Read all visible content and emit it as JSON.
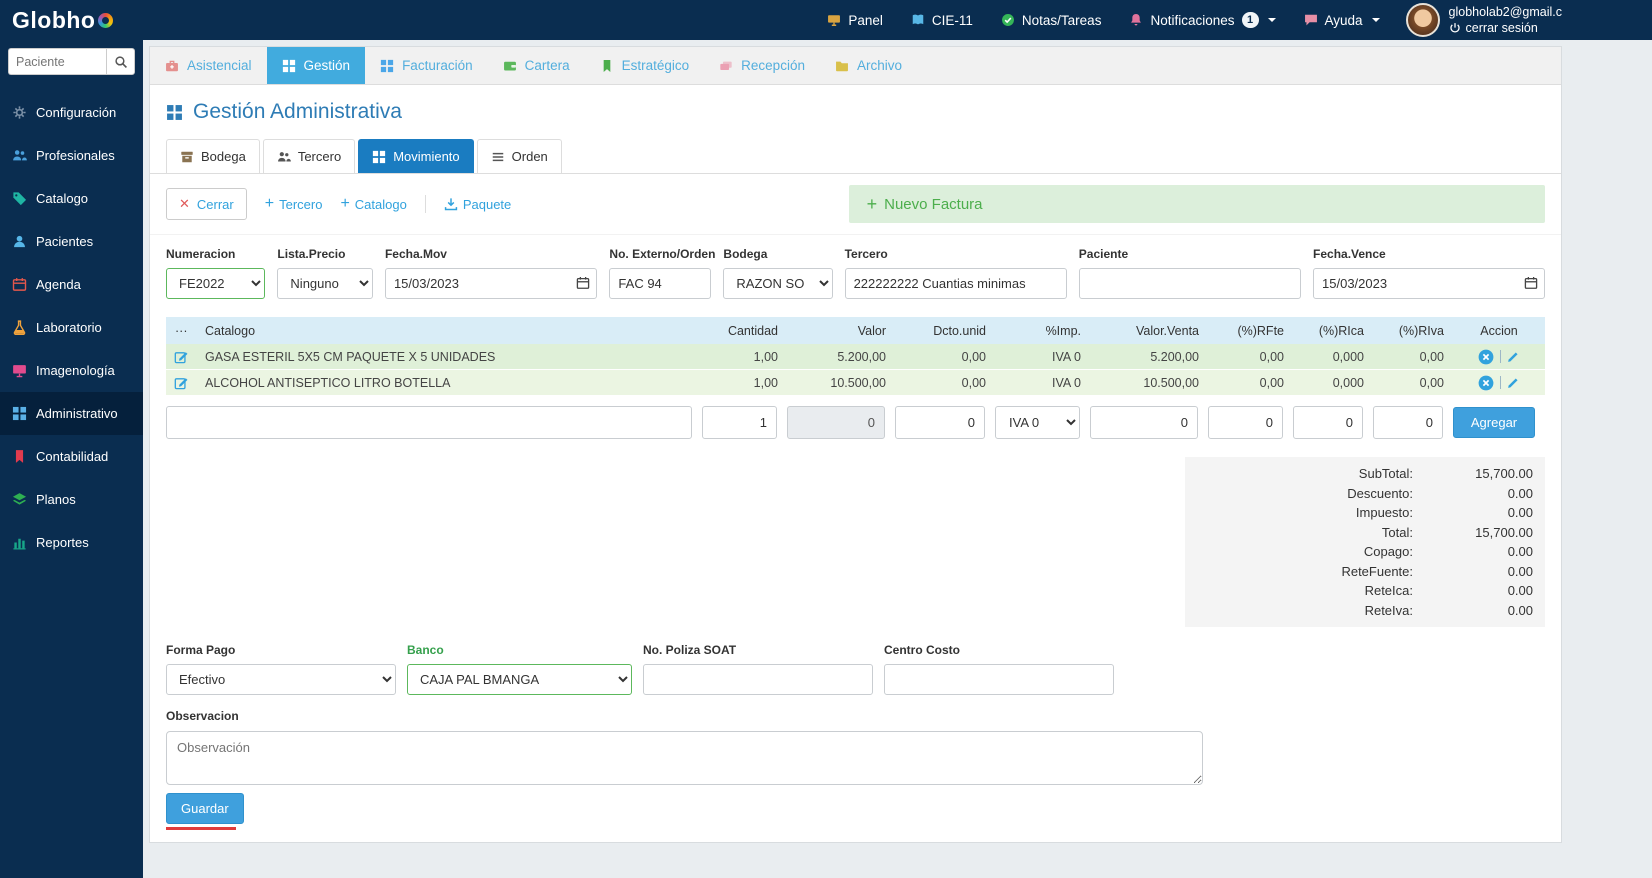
{
  "topbar": {
    "brand": "Globho",
    "nav": [
      {
        "label": "Panel"
      },
      {
        "label": "CIE-11"
      },
      {
        "label": "Notas/Tareas"
      },
      {
        "label": "Notificaciones",
        "badge": "1"
      },
      {
        "label": "Ayuda"
      }
    ],
    "user": {
      "email": "globholab2@gmail.c",
      "logout": "cerrar sesión"
    }
  },
  "sidebar": {
    "search": {
      "placeholder": "Paciente"
    },
    "items": [
      {
        "label": "Configuración"
      },
      {
        "label": "Profesionales"
      },
      {
        "label": "Catalogo"
      },
      {
        "label": "Pacientes"
      },
      {
        "label": "Agenda"
      },
      {
        "label": "Laboratorio"
      },
      {
        "label": "Imagenología"
      },
      {
        "label": "Administrativo"
      },
      {
        "label": "Contabilidad"
      },
      {
        "label": "Planos"
      },
      {
        "label": "Reportes"
      }
    ]
  },
  "module_tabs": [
    {
      "label": "Asistencial"
    },
    {
      "label": "Gestión"
    },
    {
      "label": "Facturación"
    },
    {
      "label": "Cartera"
    },
    {
      "label": "Estratégico"
    },
    {
      "label": "Recepción"
    },
    {
      "label": "Archivo"
    }
  ],
  "page": {
    "title": "Gestión Administrativa"
  },
  "subtabs": [
    {
      "label": "Bodega"
    },
    {
      "label": "Tercero"
    },
    {
      "label": "Movimiento"
    },
    {
      "label": "Orden"
    }
  ],
  "toolbar": {
    "cerrar": "Cerrar",
    "tercero": "Tercero",
    "catalogo": "Catalogo",
    "paquete": "Paquete",
    "nuevo_factura": "Nuevo Factura"
  },
  "invoice_form": {
    "numeracion": {
      "label": "Numeracion",
      "value": "FE2022"
    },
    "lista_precio": {
      "label": "Lista.Precio",
      "value": "Ninguno"
    },
    "fecha_mov": {
      "label": "Fecha.Mov",
      "value": "15/03/2023"
    },
    "no_externo": {
      "label": "No. Externo/Orden",
      "value": "FAC 94"
    },
    "bodega": {
      "label": "Bodega",
      "value": "RAZON SO"
    },
    "tercero": {
      "label": "Tercero",
      "value": "222222222 Cuantias minimas"
    },
    "paciente": {
      "label": "Paciente",
      "value": ""
    },
    "fecha_vence": {
      "label": "Fecha.Vence",
      "value": "15/03/2023"
    }
  },
  "items_table": {
    "headers": {
      "menu": "···",
      "catalogo": "Catalogo",
      "cantidad": "Cantidad",
      "valor": "Valor",
      "dcto": "Dcto.unid",
      "imp": "%Imp.",
      "valor_venta": "Valor.Venta",
      "rfte": "(%)RFte",
      "rica": "(%)RIca",
      "riva": "(%)RIva",
      "accion": "Accion"
    },
    "rows": [
      {
        "catalogo": "GASA ESTERIL 5X5 CM PAQUETE X 5 UNIDADES",
        "cantidad": "1,00",
        "valor": "5.200,00",
        "dcto": "0,00",
        "imp": "IVA 0",
        "valor_venta": "5.200,00",
        "rfte": "0,00",
        "rica": "0,000",
        "riva": "0,00"
      },
      {
        "catalogo": "ALCOHOL ANTISEPTICO LITRO BOTELLA",
        "cantidad": "1,00",
        "valor": "10.500,00",
        "dcto": "0,00",
        "imp": "IVA 0",
        "valor_venta": "10.500,00",
        "rfte": "0,00",
        "rica": "0,000",
        "riva": "0,00"
      }
    ],
    "new_row": {
      "catalogo": "",
      "cantidad": "1",
      "valor": "0",
      "dcto": "0",
      "imp": "IVA 0",
      "valor_venta": "0",
      "rfte": "0",
      "rica": "0",
      "riva": "0",
      "agregar_label": "Agregar"
    }
  },
  "totals": {
    "rows": [
      {
        "label": "SubTotal:",
        "value": "15,700.00"
      },
      {
        "label": "Descuento:",
        "value": "0.00"
      },
      {
        "label": "Impuesto:",
        "value": "0.00"
      },
      {
        "label": "Total:",
        "value": "15,700.00"
      },
      {
        "label": "Copago:",
        "value": "0.00"
      },
      {
        "label": "ReteFuente:",
        "value": "0.00"
      },
      {
        "label": "ReteIca:",
        "value": "0.00"
      },
      {
        "label": "ReteIva:",
        "value": "0.00"
      }
    ]
  },
  "payment_form": {
    "forma_pago": {
      "label": "Forma Pago",
      "value": "Efectivo"
    },
    "banco": {
      "label": "Banco",
      "value": "CAJA PAL BMANGA"
    },
    "poliza_soat": {
      "label": "No. Poliza SOAT",
      "value": ""
    },
    "centro_costo": {
      "label": "Centro Costo",
      "value": ""
    }
  },
  "observacion": {
    "label": "Observacion",
    "placeholder": "Observación"
  },
  "actions": {
    "guardar": "Guardar"
  },
  "colors": {
    "navy": "#0a2d50",
    "accent_blue": "#31a2dd",
    "green": "#5cb85c",
    "row_green": "#dff0d8",
    "table_header": "#d9edf7"
  }
}
